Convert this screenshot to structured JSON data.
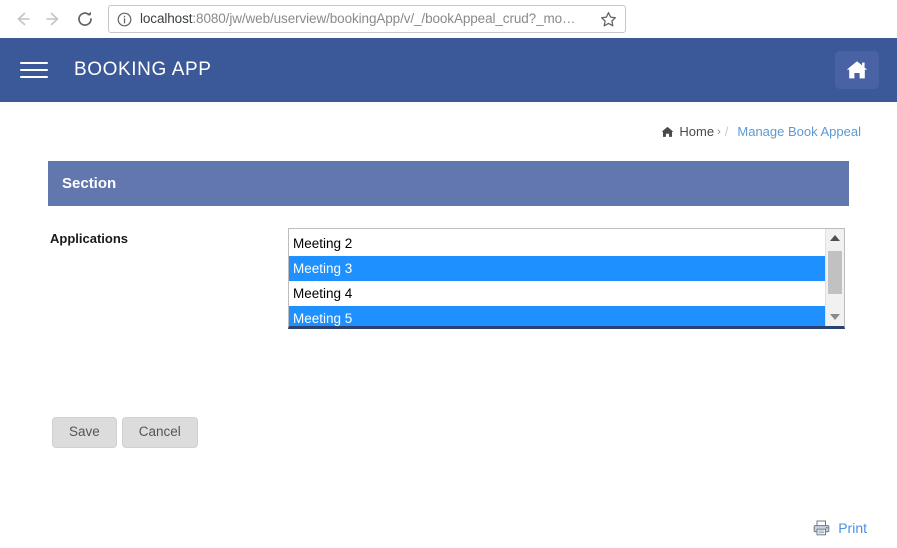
{
  "browser": {
    "back_label": "Back",
    "forward_label": "Forward",
    "reload_label": "Reload",
    "site_info_label": "site-info",
    "url": "localhost:8080/jw/web/userview/bookingApp/v/_/bookAppeal_crud?_mo…",
    "url_host": "localhost",
    "url_rest": ":8080/jw/web/userview/bookingApp/v/_/bookAppeal_crud?_mo…",
    "bookmark_label": "Bookmark this page"
  },
  "header": {
    "menu_label": "Menu",
    "title": "BOOKING APP",
    "home_button_label": "Home",
    "bg_color": "#3b5998",
    "home_button_bg": "#4962a4"
  },
  "breadcrumb": {
    "home_label": "Home",
    "caret": "›",
    "separator": "/",
    "current_label": "Manage Book Appeal",
    "link_color": "#5b9bd5"
  },
  "section": {
    "title": "Section",
    "bg_color": "#6277ad"
  },
  "form": {
    "applications": {
      "label": "Applications",
      "options": [
        {
          "label": "Meeting 2",
          "selected": false
        },
        {
          "label": "Meeting 3",
          "selected": true
        },
        {
          "label": "Meeting 4",
          "selected": false
        },
        {
          "label": "Meeting 5",
          "selected": true
        }
      ],
      "selected_color": "#1e90ff",
      "scroll_up_label": "Scroll up",
      "scroll_down_label": "Scroll down"
    }
  },
  "actions": {
    "save_label": "Save",
    "cancel_label": "Cancel"
  },
  "footer": {
    "print_label": "Print",
    "print_color": "#4a90e2"
  }
}
